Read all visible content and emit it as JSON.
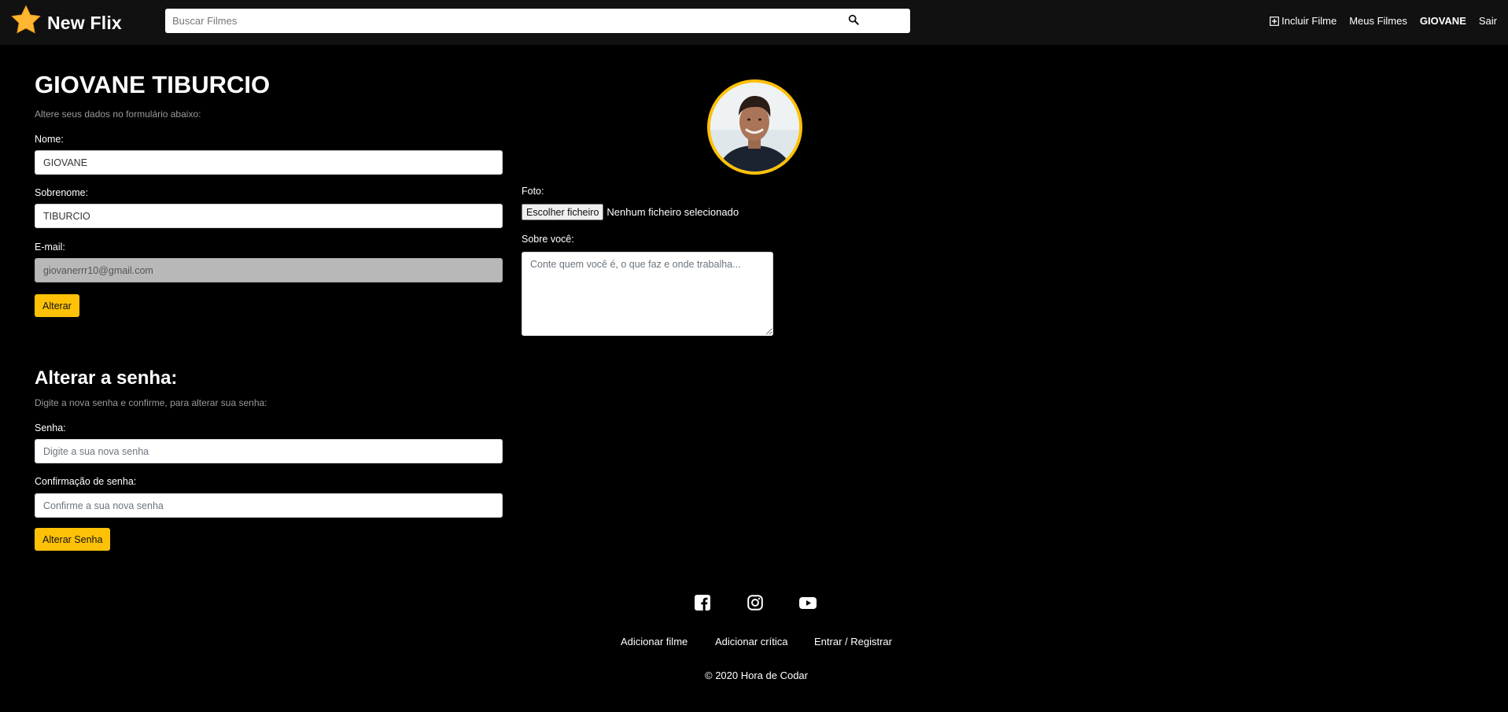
{
  "navbar": {
    "brand": "New Flix",
    "search_placeholder": "Buscar Filmes",
    "links": {
      "add_movie": "Incluir Filme",
      "my_movies": "Meus Filmes",
      "user": "GIOVANE",
      "logout": "Sair"
    }
  },
  "profile": {
    "title": "GIOVANE TIBURCIO",
    "subtitle": "Altere seus dados no formulário abaixo:",
    "first_name_label": "Nome:",
    "first_name_value": "GIOVANE",
    "last_name_label": "Sobrenome:",
    "last_name_value": "TIBURCIO",
    "email_label": "E-mail:",
    "email_value": "giovanerrr10@gmail.com",
    "submit_label": "Alterar",
    "photo_label": "Foto:",
    "file_button": "Escolher ficheiro",
    "file_status": "Nenhum ficheiro selecionado",
    "about_label": "Sobre você:",
    "about_placeholder": "Conte quem você é, o que faz e onde trabalha..."
  },
  "password": {
    "title": "Alterar a senha:",
    "subtitle": "Digite a nova senha e confirme, para alterar sua senha:",
    "password_label": "Senha:",
    "password_placeholder": "Digite a sua nova senha",
    "confirm_label": "Confirmação de senha:",
    "confirm_placeholder": "Confirme a sua nova senha",
    "submit_label": "Alterar Senha"
  },
  "footer": {
    "social_icons": [
      "facebook-icon",
      "instagram-icon",
      "youtube-icon"
    ],
    "links": [
      "Adicionar filme",
      "Adicionar crítica",
      "Entrar / Registrar"
    ],
    "copyright": "© 2020 Hora de Codar"
  },
  "colors": {
    "accent": "#ffc107",
    "navbar_bg": "#111111",
    "page_bg": "#000000"
  }
}
